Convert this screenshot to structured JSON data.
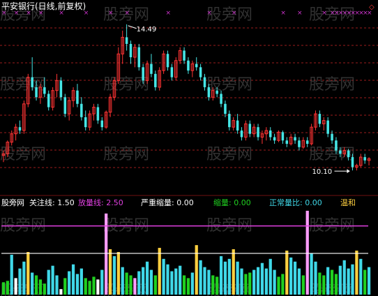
{
  "header": {
    "title": "平安银行(日线,前复权)",
    "title_color": "#ffffff"
  },
  "watermark": {
    "text": "股旁网",
    "color": "#5a5a5a"
  },
  "top_marker": {
    "glyph": "◇",
    "color": "#ff3b3b"
  },
  "colors": {
    "background": "#000000",
    "grid": "#9b1b1b",
    "candle_up": "#ff3333",
    "candle_down": "#46e6e6",
    "marker": "#cc33cc",
    "line_magenta": "#e040e0",
    "line_white": "#ffffff",
    "bar_white": "#ffffff",
    "bar_pink": "#ff9cff",
    "bar_yellow": "#ffd040",
    "bar_green": "#20d020",
    "bar_cyan": "#40d8e8"
  },
  "indicator_legend": [
    {
      "label": "股旁网",
      "value": "",
      "color": "#ffffff"
    },
    {
      "label": "关注线:",
      "value": "1.50",
      "color": "#ffffff"
    },
    {
      "label": "放量线:",
      "value": "2.50",
      "color": "#e040e0"
    },
    {
      "label": "严重缩量:",
      "value": "0.00",
      "color": "#ffffff"
    },
    {
      "label": "缩量:",
      "value": "0.00",
      "color": "#20d020"
    },
    {
      "label": "正常量比:",
      "value": "0.00",
      "color": "#40d8e8"
    },
    {
      "label": "温和",
      "value": "",
      "color": "#ffd040"
    }
  ],
  "chart_data": [
    {
      "type": "candlestick",
      "title": "平安银行(日线,前复权)",
      "annotations": [
        {
          "label": "14.49",
          "kind": "high"
        },
        {
          "label": "10.10",
          "kind": "low"
        }
      ],
      "price_range": [
        9.6,
        14.8
      ],
      "series": [
        {
          "name": "price",
          "values": [
            [
              10.55,
              10.7,
              10.35,
              10.6
            ],
            [
              10.6,
              11.0,
              10.5,
              10.95
            ],
            [
              10.95,
              11.3,
              10.85,
              11.2
            ],
            [
              11.2,
              11.5,
              11.0,
              11.4
            ],
            [
              11.4,
              11.6,
              11.2,
              11.3
            ],
            [
              11.3,
              12.2,
              11.2,
              12.1
            ],
            [
              12.1,
              13.0,
              12.0,
              12.9
            ],
            [
              12.9,
              13.5,
              12.5,
              12.6
            ],
            [
              12.6,
              12.8,
              12.2,
              12.3
            ],
            [
              12.3,
              12.7,
              12.1,
              12.6
            ],
            [
              12.6,
              12.9,
              12.3,
              12.4
            ],
            [
              12.4,
              12.5,
              11.9,
              12.0
            ],
            [
              12.0,
              12.6,
              11.9,
              12.5
            ],
            [
              12.5,
              13.0,
              12.3,
              12.8
            ],
            [
              12.8,
              12.9,
              12.2,
              12.3
            ],
            [
              12.3,
              12.4,
              11.7,
              11.8
            ],
            [
              11.8,
              12.3,
              11.6,
              12.2
            ],
            [
              12.2,
              12.6,
              12.0,
              12.5
            ],
            [
              12.5,
              12.7,
              12.0,
              12.1
            ],
            [
              12.1,
              12.3,
              11.6,
              11.7
            ],
            [
              11.7,
              11.9,
              11.3,
              11.4
            ],
            [
              11.4,
              11.9,
              11.3,
              11.8
            ],
            [
              11.8,
              12.1,
              11.6,
              12.0
            ],
            [
              12.0,
              12.1,
              11.5,
              11.6
            ],
            [
              11.6,
              11.7,
              11.3,
              11.4
            ],
            [
              11.4,
              11.9,
              11.35,
              11.85
            ],
            [
              11.85,
              12.4,
              11.7,
              12.3
            ],
            [
              12.3,
              12.9,
              12.2,
              12.8
            ],
            [
              12.8,
              13.8,
              12.7,
              13.6
            ],
            [
              13.6,
              14.3,
              13.3,
              14.1
            ],
            [
              14.1,
              14.49,
              13.7,
              13.9
            ],
            [
              13.9,
              14.0,
              13.3,
              13.5
            ],
            [
              13.5,
              13.9,
              13.2,
              13.8
            ],
            [
              13.8,
              13.9,
              13.1,
              13.2
            ],
            [
              13.2,
              13.3,
              12.7,
              12.8
            ],
            [
              12.8,
              13.4,
              12.7,
              13.3
            ],
            [
              13.3,
              13.6,
              12.9,
              13.0
            ],
            [
              13.0,
              13.1,
              12.5,
              12.6
            ],
            [
              12.6,
              13.2,
              12.5,
              13.1
            ],
            [
              13.1,
              13.7,
              13.0,
              13.6
            ],
            [
              13.6,
              13.7,
              13.1,
              13.2
            ],
            [
              13.2,
              13.3,
              12.8,
              12.9
            ],
            [
              12.9,
              13.5,
              12.8,
              13.4
            ],
            [
              13.4,
              13.8,
              13.3,
              13.7
            ],
            [
              13.7,
              13.8,
              13.3,
              13.4
            ],
            [
              13.4,
              13.5,
              13.0,
              13.1
            ],
            [
              13.1,
              13.4,
              12.9,
              13.3
            ],
            [
              13.3,
              13.5,
              13.1,
              13.2
            ],
            [
              13.2,
              13.3,
              12.8,
              12.9
            ],
            [
              12.9,
              13.0,
              12.5,
              12.6
            ],
            [
              12.6,
              12.7,
              12.2,
              12.3
            ],
            [
              12.3,
              12.6,
              12.2,
              12.5
            ],
            [
              12.5,
              12.6,
              12.3,
              12.4
            ],
            [
              12.4,
              12.5,
              12.0,
              12.1
            ],
            [
              12.1,
              12.2,
              11.7,
              11.8
            ],
            [
              11.8,
              11.9,
              11.3,
              11.4
            ],
            [
              11.4,
              11.7,
              11.3,
              11.6
            ],
            [
              11.6,
              11.8,
              11.2,
              11.3
            ],
            [
              11.3,
              11.4,
              11.0,
              11.1
            ],
            [
              11.1,
              11.6,
              11.0,
              11.5
            ],
            [
              11.5,
              11.6,
              11.1,
              11.2
            ],
            [
              11.2,
              11.5,
              11.1,
              11.4
            ],
            [
              11.4,
              11.5,
              11.0,
              11.1
            ],
            [
              11.1,
              11.3,
              10.9,
              11.2
            ],
            [
              11.2,
              11.4,
              11.0,
              11.3
            ],
            [
              11.3,
              11.4,
              11.0,
              11.1
            ],
            [
              11.1,
              11.2,
              10.9,
              11.0
            ],
            [
              11.0,
              11.3,
              10.95,
              11.25
            ],
            [
              11.25,
              11.3,
              10.9,
              11.0
            ],
            [
              11.0,
              11.1,
              10.8,
              10.9
            ],
            [
              10.9,
              11.2,
              10.85,
              11.1
            ],
            [
              11.1,
              11.2,
              10.9,
              11.0
            ],
            [
              11.0,
              11.1,
              10.7,
              10.8
            ],
            [
              10.8,
              11.1,
              10.75,
              11.0
            ],
            [
              11.0,
              11.1,
              10.8,
              10.9
            ],
            [
              10.9,
              11.5,
              10.85,
              11.4
            ],
            [
              11.4,
              11.9,
              11.3,
              11.8
            ],
            [
              11.8,
              11.9,
              11.4,
              11.5
            ],
            [
              11.5,
              11.7,
              11.3,
              11.6
            ],
            [
              11.6,
              11.7,
              11.1,
              11.2
            ],
            [
              11.2,
              11.3,
              10.9,
              11.0
            ],
            [
              11.0,
              11.1,
              10.6,
              10.7
            ],
            [
              10.7,
              10.8,
              10.5,
              10.6
            ],
            [
              10.6,
              10.8,
              10.5,
              10.7
            ],
            [
              10.7,
              10.75,
              10.4,
              10.5
            ],
            [
              10.5,
              10.6,
              10.1,
              10.2
            ],
            [
              10.2,
              10.3,
              10.1,
              10.25
            ],
            [
              10.25,
              10.6,
              10.2,
              10.5
            ],
            [
              10.5,
              10.6,
              10.3,
              10.4
            ],
            [
              10.4,
              10.5,
              10.25,
              10.45
            ]
          ]
        }
      ]
    },
    {
      "type": "bar",
      "lines": [
        {
          "name": "关注线",
          "value": 1.5
        },
        {
          "name": "放量线",
          "value": 2.5
        }
      ],
      "y_range": [
        0,
        3.2
      ],
      "classes": [
        "white",
        "pink",
        "yellow",
        "green",
        "cyan"
      ],
      "values": [
        [
          0.45,
          "green"
        ],
        [
          0.5,
          "green"
        ],
        [
          1.45,
          "cyan"
        ],
        [
          0.6,
          "white"
        ],
        [
          0.95,
          "cyan"
        ],
        [
          1.2,
          "cyan"
        ],
        [
          1.55,
          "yellow"
        ],
        [
          0.8,
          "cyan"
        ],
        [
          0.7,
          "green"
        ],
        [
          0.55,
          "green"
        ],
        [
          0.4,
          "green"
        ],
        [
          0.9,
          "cyan"
        ],
        [
          1.05,
          "cyan"
        ],
        [
          0.7,
          "cyan"
        ],
        [
          0.2,
          "white"
        ],
        [
          0.6,
          "green"
        ],
        [
          0.85,
          "cyan"
        ],
        [
          1.1,
          "cyan"
        ],
        [
          0.75,
          "cyan"
        ],
        [
          0.95,
          "cyan"
        ],
        [
          0.6,
          "green"
        ],
        [
          0.5,
          "green"
        ],
        [
          0.65,
          "green"
        ],
        [
          0.55,
          "white"
        ],
        [
          0.9,
          "cyan"
        ],
        [
          2.95,
          "pink"
        ],
        [
          1.65,
          "yellow"
        ],
        [
          1.4,
          "cyan"
        ],
        [
          1.55,
          "yellow"
        ],
        [
          1.0,
          "cyan"
        ],
        [
          0.8,
          "green"
        ],
        [
          0.7,
          "green"
        ],
        [
          0.6,
          "pink"
        ],
        [
          0.85,
          "cyan"
        ],
        [
          1.0,
          "cyan"
        ],
        [
          1.2,
          "cyan"
        ],
        [
          0.9,
          "cyan"
        ],
        [
          0.7,
          "green"
        ],
        [
          1.7,
          "yellow"
        ],
        [
          1.3,
          "cyan"
        ],
        [
          1.1,
          "cyan"
        ],
        [
          0.85,
          "cyan"
        ],
        [
          0.95,
          "cyan"
        ],
        [
          1.05,
          "cyan"
        ],
        [
          0.7,
          "green"
        ],
        [
          0.6,
          "green"
        ],
        [
          0.8,
          "cyan"
        ],
        [
          1.8,
          "yellow"
        ],
        [
          1.25,
          "cyan"
        ],
        [
          1.0,
          "cyan"
        ],
        [
          0.9,
          "cyan"
        ],
        [
          0.7,
          "green"
        ],
        [
          0.65,
          "green"
        ],
        [
          1.4,
          "cyan"
        ],
        [
          1.2,
          "cyan"
        ],
        [
          1.3,
          "cyan"
        ],
        [
          1.65,
          "yellow"
        ],
        [
          1.2,
          "cyan"
        ],
        [
          0.95,
          "cyan"
        ],
        [
          0.75,
          "green"
        ],
        [
          0.8,
          "green"
        ],
        [
          0.9,
          "cyan"
        ],
        [
          1.0,
          "cyan"
        ],
        [
          1.15,
          "cyan"
        ],
        [
          0.95,
          "cyan"
        ],
        [
          1.3,
          "cyan"
        ],
        [
          0.9,
          "cyan"
        ],
        [
          0.65,
          "green"
        ],
        [
          0.75,
          "green"
        ],
        [
          1.6,
          "yellow"
        ],
        [
          1.35,
          "cyan"
        ],
        [
          1.2,
          "cyan"
        ],
        [
          0.95,
          "cyan"
        ],
        [
          0.7,
          "green"
        ],
        [
          3.05,
          "pink"
        ],
        [
          1.5,
          "cyan"
        ],
        [
          1.2,
          "cyan"
        ],
        [
          0.8,
          "green"
        ],
        [
          0.7,
          "green"
        ],
        [
          1.0,
          "cyan"
        ],
        [
          0.9,
          "green"
        ],
        [
          0.75,
          "green"
        ],
        [
          1.05,
          "cyan"
        ],
        [
          1.25,
          "cyan"
        ],
        [
          0.95,
          "cyan"
        ],
        [
          1.1,
          "cyan"
        ],
        [
          1.6,
          "yellow"
        ],
        [
          1.3,
          "cyan"
        ],
        [
          0.9,
          "green"
        ],
        [
          1.0,
          "cyan"
        ]
      ]
    }
  ]
}
